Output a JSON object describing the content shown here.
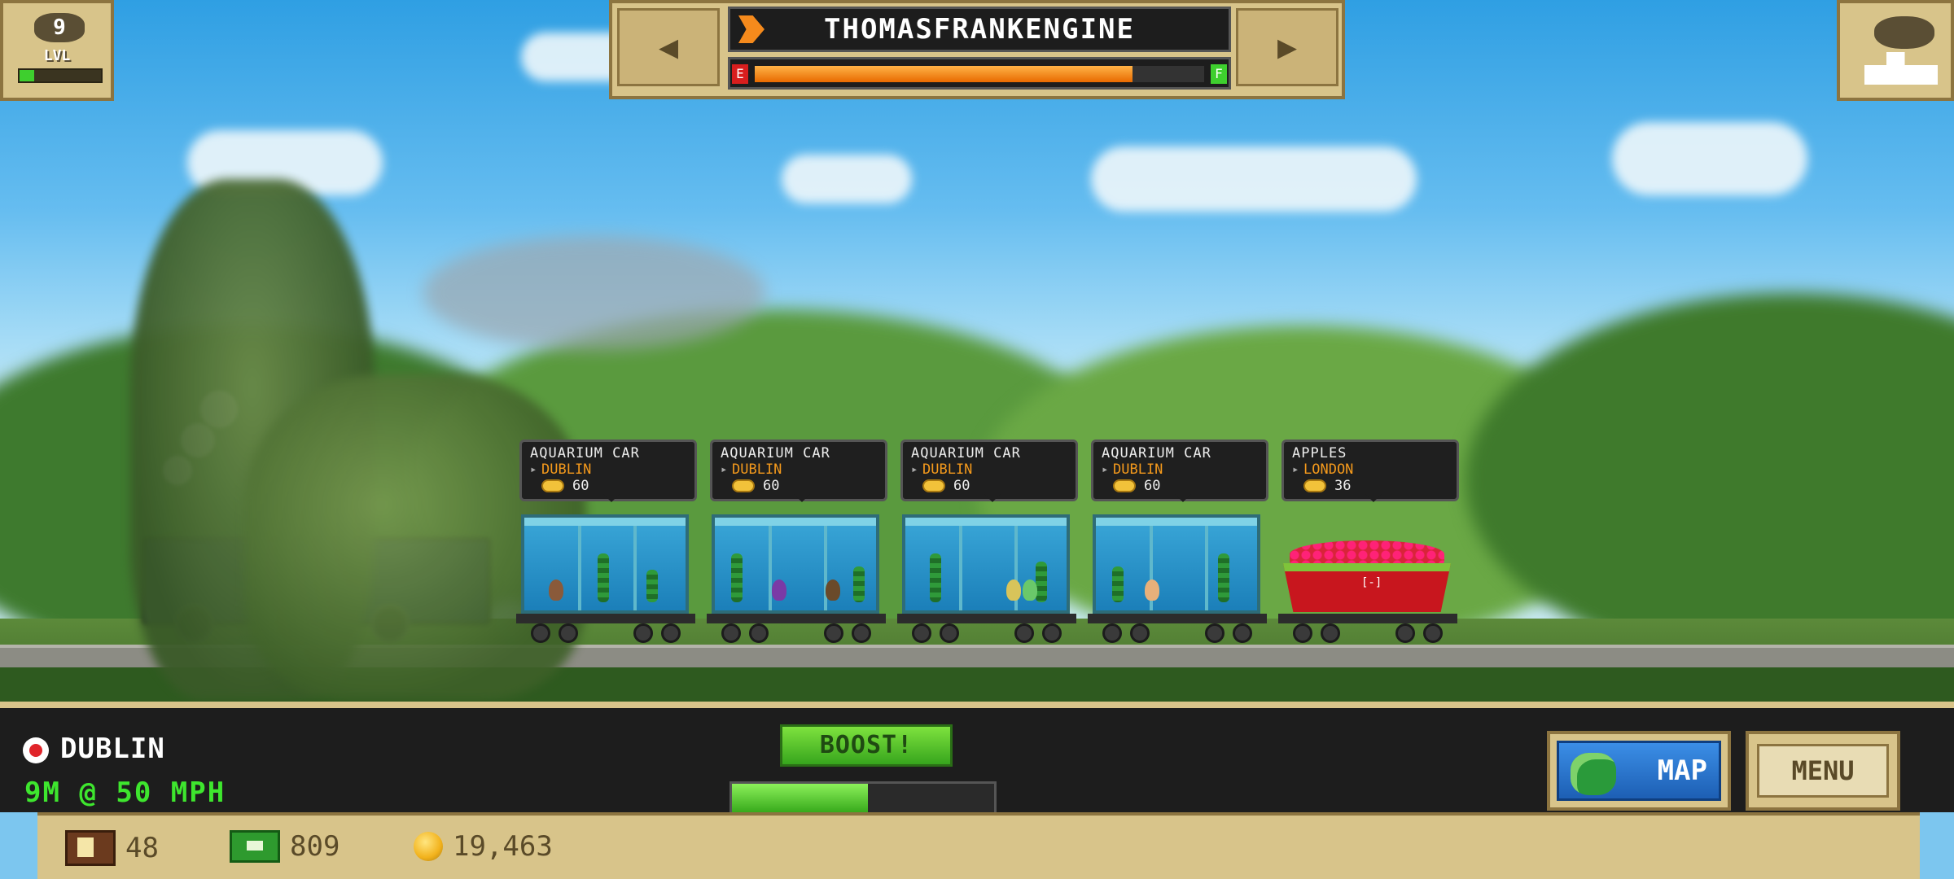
{
  "hud": {
    "level": "9",
    "level_label": "LVL",
    "level_progress": 0.18,
    "engine_name": "THOMASFRANKENGINE",
    "fuel_empty_label": "E",
    "fuel_full_label": "F",
    "fuel_level": 0.84,
    "prev_arrow": "◀",
    "next_arrow": "▶"
  },
  "cars": [
    {
      "name": "AQUARIUM CAR",
      "destination": "DUBLIN",
      "payout": "60"
    },
    {
      "name": "AQUARIUM CAR",
      "destination": "DUBLIN",
      "payout": "60"
    },
    {
      "name": "AQUARIUM CAR",
      "destination": "DUBLIN",
      "payout": "60"
    },
    {
      "name": "AQUARIUM CAR",
      "destination": "DUBLIN",
      "payout": "60"
    },
    {
      "name": "APPLES",
      "destination": "LONDON",
      "payout": "36"
    }
  ],
  "status": {
    "station": "DUBLIN",
    "distance_speed": "9M @ 50 MPH",
    "boost_label": "BOOST!",
    "boost_level": 0.52
  },
  "buttons": {
    "map_label": "MAP",
    "menu_label": "MENU",
    "apple_mark": "[-]"
  },
  "resources": {
    "crates": "48",
    "cash": "809",
    "coins": "19,463"
  },
  "colors": {
    "panel": "#d8c48a",
    "panel_border": "#8c7440",
    "destination": "#f59a1c",
    "speed_text": "#3ee62e",
    "map_button": "#2a75d0"
  }
}
